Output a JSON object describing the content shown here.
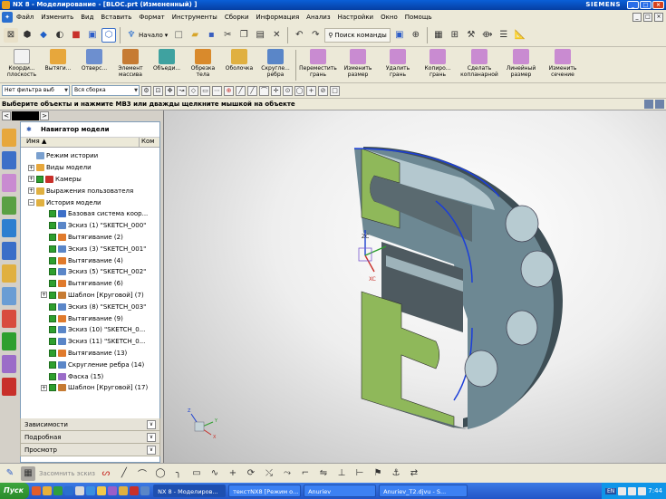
{
  "window": {
    "title": "NX 8 - Моделирование - [BLOC.prt (Измененный) ]",
    "brand": "SIEMENS",
    "controls": [
      "_",
      "□",
      "×"
    ]
  },
  "menu": {
    "items": [
      "Файл",
      "Изменить",
      "Вид",
      "Вставить",
      "Формат",
      "Инструменты",
      "Сборки",
      "Информация",
      "Анализ",
      "Настройки",
      "Окно",
      "Помощь"
    ],
    "right_controls": [
      "_",
      "□",
      "×"
    ]
  },
  "toolbar_top": {
    "start_label": "Начало",
    "search_label": "Поиск команды"
  },
  "toolbar_features": {
    "tools": [
      {
        "label": "Коорди... плоскость",
        "color": "#e8e8e8"
      },
      {
        "label": "Вытяги...",
        "color": "#e7a73c"
      },
      {
        "label": "Отверс...",
        "color": "#6d8fcf"
      },
      {
        "label": "Элемент массива",
        "color": "#c67b33"
      },
      {
        "label": "Объеди...",
        "color": "#3fa2a0"
      },
      {
        "label": "Обрезка тела",
        "color": "#d98a2c"
      },
      {
        "label": "Оболочка",
        "color": "#e0b040"
      },
      {
        "label": "Скругле... ребра",
        "color": "#5a86c8"
      },
      {
        "label": "Переместить грань",
        "color": "#c98bd1"
      },
      {
        "label": "Изменить размер",
        "color": "#c98bd1"
      },
      {
        "label": "Удалить грань",
        "color": "#c98bd1"
      },
      {
        "label": "Копиро... грань",
        "color": "#c98bd1"
      },
      {
        "label": "Сделать копланарной",
        "color": "#c98bd1"
      },
      {
        "label": "Линейный размер",
        "color": "#c98bd1"
      },
      {
        "label": "Изменить сечение",
        "color": "#c98bd1"
      }
    ]
  },
  "selection_bar": {
    "filter_value": "Нет фильтра выб",
    "scope_value": "Вся сборка"
  },
  "cue_line": "Выберите объекты и нажмите MB3 или дважды щелкните мышкой на объекте",
  "navigator": {
    "title": "Навигатор модели",
    "col_name": "Имя",
    "col_comment": "Ком",
    "items": [
      {
        "label": "Режим истории",
        "level": 0,
        "icon": "clock-icon",
        "expand": "",
        "check": false
      },
      {
        "label": "Виды модели",
        "level": 0,
        "icon": "views-icon",
        "expand": "+",
        "check": false
      },
      {
        "label": "Камеры",
        "level": 0,
        "icon": "camera-icon",
        "expand": "+",
        "check": true
      },
      {
        "label": "Выражения пользователя",
        "level": 0,
        "icon": "folder-icon",
        "expand": "+",
        "check": false
      },
      {
        "label": "История модели",
        "level": 0,
        "icon": "folder-icon",
        "expand": "−",
        "check": false
      },
      {
        "label": "Базовая система коор...",
        "level": 1,
        "icon": "csys-icon",
        "expand": "",
        "check": true
      },
      {
        "label": "Эскиз (1) \"SKETCH_000\"",
        "level": 1,
        "icon": "sketch-icon",
        "expand": "",
        "check": true
      },
      {
        "label": "Вытягивание (2)",
        "level": 1,
        "icon": "extrude-icon",
        "expand": "",
        "check": true
      },
      {
        "label": "Эскиз (3) \"SKETCH_001\"",
        "level": 1,
        "icon": "sketch-icon",
        "expand": "",
        "check": true
      },
      {
        "label": "Вытягивание (4)",
        "level": 1,
        "icon": "extrude-icon",
        "expand": "",
        "check": true
      },
      {
        "label": "Эскиз (5) \"SKETCH_002\"",
        "level": 1,
        "icon": "sketch-icon",
        "expand": "",
        "check": true
      },
      {
        "label": "Вытягивание (6)",
        "level": 1,
        "icon": "extrude-icon",
        "expand": "",
        "check": true
      },
      {
        "label": "Шаблон [Круговой] (7)",
        "level": 1,
        "icon": "pattern-icon",
        "expand": "+",
        "check": true
      },
      {
        "label": "Эскиз (8) \"SKETCH_003\"",
        "level": 1,
        "icon": "sketch-icon",
        "expand": "",
        "check": true
      },
      {
        "label": "Вытягивание (9)",
        "level": 1,
        "icon": "extrude-icon",
        "expand": "",
        "check": true
      },
      {
        "label": "Эскиз (10) \"SKETCH_0...",
        "level": 1,
        "icon": "sketch-icon",
        "expand": "",
        "check": true
      },
      {
        "label": "Эскиз (11) \"SKETCH_0...",
        "level": 1,
        "icon": "sketch-icon",
        "expand": "",
        "check": true
      },
      {
        "label": "Вытягивание (13)",
        "level": 1,
        "icon": "extrude-icon",
        "expand": "",
        "check": true
      },
      {
        "label": "Скругление ребра (14)",
        "level": 1,
        "icon": "blend-icon",
        "expand": "",
        "check": true
      },
      {
        "label": "Фаска (15)",
        "level": 1,
        "icon": "chamfer-icon",
        "expand": "",
        "check": true
      },
      {
        "label": "Шаблон [Круговой] (17)",
        "level": 1,
        "icon": "pattern-icon",
        "expand": "+",
        "check": true
      }
    ],
    "panels": [
      "Зависимости",
      "Подробная",
      "Просмотр"
    ]
  },
  "viewport": {
    "axis_labels": {
      "zc": "ZC",
      "xc": "XC",
      "triad_z": "Z",
      "triad_x": "X",
      "triad_y": "Y"
    }
  },
  "sketch_bar": {
    "greyed_label": "Засомнить эскиз"
  },
  "taskbar": {
    "start": "Пуск",
    "tasks": [
      "NX 8 - Моделиров...",
      "текстNX8 [Режим о...",
      "Anuriev",
      "Anuriev_T2.djvu - S..."
    ],
    "lang": "EN",
    "clock": "7:44"
  }
}
